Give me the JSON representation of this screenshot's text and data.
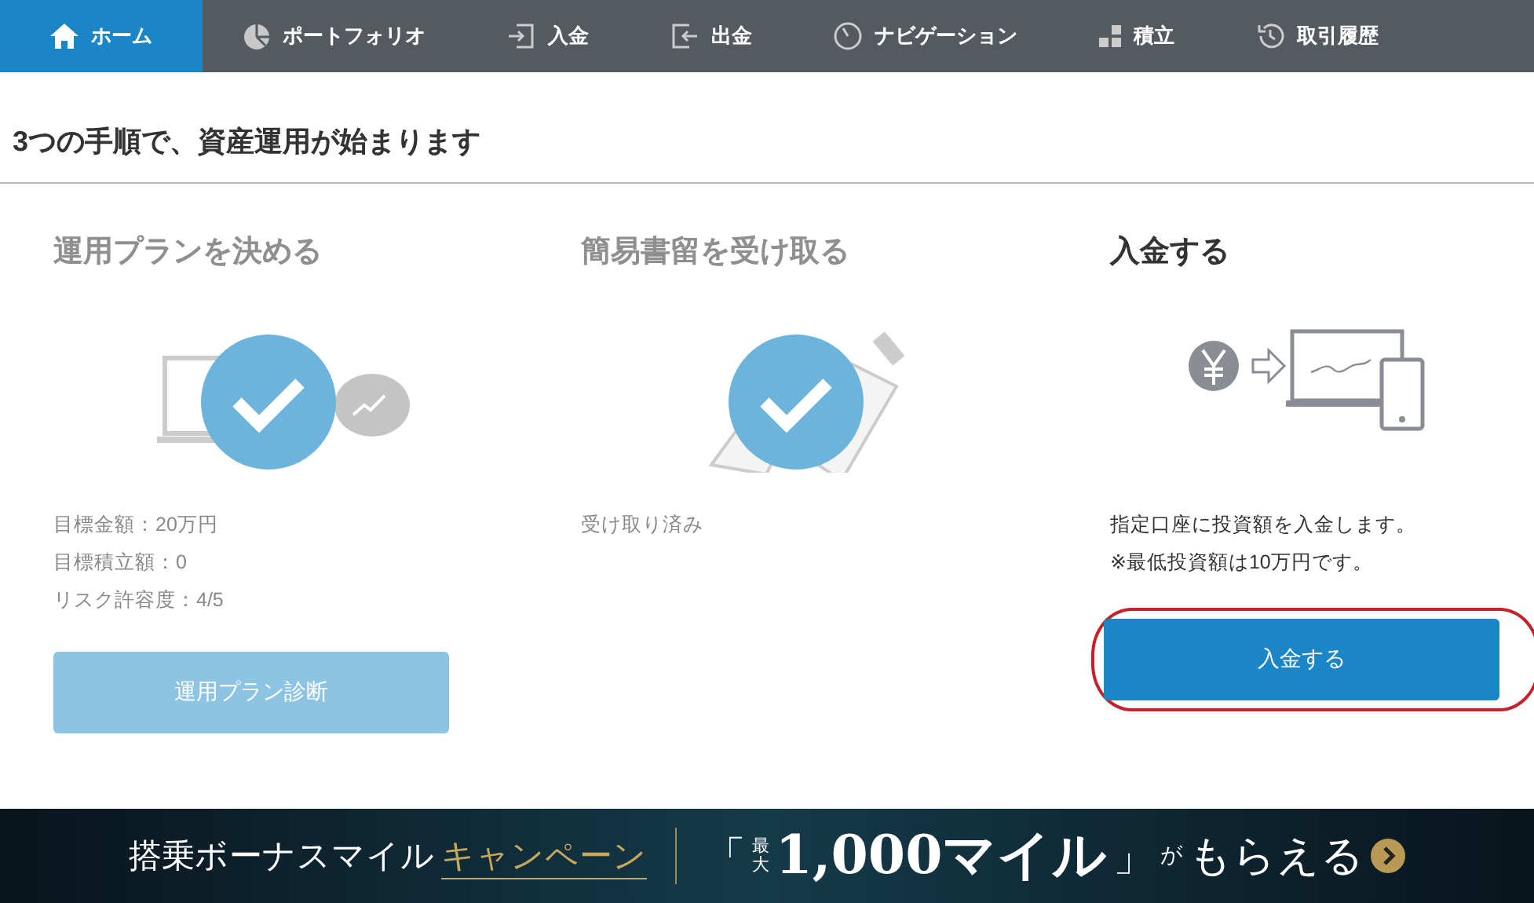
{
  "nav": {
    "items": [
      {
        "label": "ホーム",
        "selected": true
      },
      {
        "label": "ポートフォリオ",
        "selected": false
      },
      {
        "label": "入金",
        "selected": false
      },
      {
        "label": "出金",
        "selected": false
      },
      {
        "label": "ナビゲーション",
        "selected": false
      },
      {
        "label": "積立",
        "selected": false
      },
      {
        "label": "取引履歴",
        "selected": false
      }
    ]
  },
  "heading": "3つの手順で、資産運用が始まります",
  "steps": [
    {
      "kind": "plan",
      "title": "運用プランを決める",
      "completed": true,
      "details": [
        "目標金額：20万円",
        "目標積立額：0",
        "リスク許容度：4/5"
      ],
      "button": {
        "label": "運用プラン診断",
        "highlighted": false
      }
    },
    {
      "kind": "mail",
      "title": "簡易書留を受け取る",
      "completed": true,
      "details": [
        "受け取り済み"
      ]
    },
    {
      "kind": "deposit",
      "title": "入金する",
      "completed": false,
      "details": [
        "指定口座に投資額を入金します。",
        "※最低投資額は10万円です。"
      ],
      "button": {
        "label": "入金する",
        "highlighted": true
      }
    }
  ],
  "banner": {
    "segments": [
      {
        "kind": "plain",
        "text": "搭乗ボーナスマイル"
      },
      {
        "kind": "gold",
        "text": "キャンペーン"
      },
      {
        "kind": "bracket",
        "text": "「"
      },
      {
        "kind": "small",
        "text": "最大"
      },
      {
        "kind": "big",
        "text": "1,000マイル"
      },
      {
        "kind": "bracket",
        "text": "」"
      },
      {
        "kind": "tiny",
        "text": "が"
      },
      {
        "kind": "plain_large",
        "text": "もらえる"
      }
    ]
  }
}
